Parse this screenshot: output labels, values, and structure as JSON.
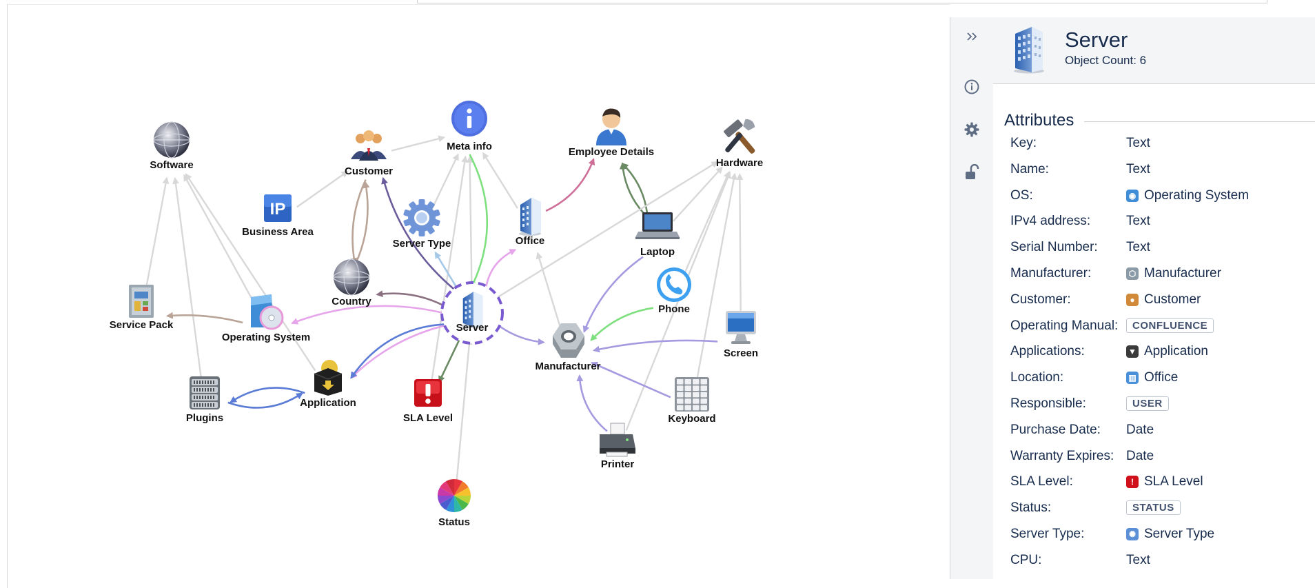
{
  "graph": {
    "nodes": [
      {
        "id": "software",
        "label": "Software",
        "icon": "globe-icon"
      },
      {
        "id": "customer",
        "label": "Customer",
        "icon": "people-icon"
      },
      {
        "id": "metainfo",
        "label": "Meta info",
        "icon": "info-icon"
      },
      {
        "id": "employee",
        "label": "Employee Details",
        "icon": "person-icon"
      },
      {
        "id": "hardware",
        "label": "Hardware",
        "icon": "tools-icon"
      },
      {
        "id": "businessarea",
        "label": "Business Area",
        "icon": "ip-icon"
      },
      {
        "id": "servertype",
        "label": "Server Type",
        "icon": "gear-icon"
      },
      {
        "id": "office",
        "label": "Office",
        "icon": "building-icon"
      },
      {
        "id": "laptop",
        "label": "Laptop",
        "icon": "laptop-icon"
      },
      {
        "id": "country",
        "label": "Country",
        "icon": "globe-icon"
      },
      {
        "id": "phone",
        "label": "Phone",
        "icon": "phone-icon"
      },
      {
        "id": "servicepack",
        "label": "Service Pack",
        "icon": "servicepack-icon"
      },
      {
        "id": "os",
        "label": "Operating System",
        "icon": "cd-icon"
      },
      {
        "id": "server",
        "label": "Server",
        "icon": "server-icon"
      },
      {
        "id": "manufacturer",
        "label": "Manufacturer",
        "icon": "nut-icon"
      },
      {
        "id": "screen",
        "label": "Screen",
        "icon": "monitor-icon"
      },
      {
        "id": "plugins",
        "label": "Plugins",
        "icon": "rack-icon"
      },
      {
        "id": "application",
        "label": "Application",
        "icon": "package-icon"
      },
      {
        "id": "sla",
        "label": "SLA Level",
        "icon": "alert-icon"
      },
      {
        "id": "keyboard",
        "label": "Keyboard",
        "icon": "keypad-icon"
      },
      {
        "id": "printer",
        "label": "Printer",
        "icon": "printer-icon"
      },
      {
        "id": "status",
        "label": "Status",
        "icon": "colorwheel-icon"
      }
    ],
    "selected": "server"
  },
  "toolbar": {
    "collapse_icon": "double-chevron-right-icon",
    "info_icon": "info-circle-icon",
    "settings_icon": "gear-icon",
    "lock_icon": "unlock-icon"
  },
  "panel": {
    "icon": "server-icon",
    "title": "Server",
    "count_text": "Object Count: 6",
    "attributes_title": "Attributes",
    "attributes": [
      {
        "key": "Key:",
        "value": "Text",
        "kind": "text"
      },
      {
        "key": "Name:",
        "value": "Text",
        "kind": "text"
      },
      {
        "key": "OS:",
        "value": "Operating System",
        "kind": "object",
        "icon": "cd-icon",
        "color": "#3f8dd6"
      },
      {
        "key": "IPv4 address:",
        "value": "Text",
        "kind": "text"
      },
      {
        "key": "Serial Number:",
        "value": "Text",
        "kind": "text"
      },
      {
        "key": "Manufacturer:",
        "value": "Manufacturer",
        "kind": "object",
        "icon": "nut-icon",
        "color": "#8a9aa6"
      },
      {
        "key": "Customer:",
        "value": "Customer",
        "kind": "object",
        "icon": "people-icon",
        "color": "#d08a3a"
      },
      {
        "key": "Operating Manual:",
        "value": "CONFLUENCE",
        "kind": "badge"
      },
      {
        "key": "Applications:",
        "value": "Application",
        "kind": "object",
        "icon": "package-icon",
        "color": "#3a3a3a"
      },
      {
        "key": "Location:",
        "value": "Office",
        "kind": "object",
        "icon": "building-icon",
        "color": "#4a90d9"
      },
      {
        "key": "Responsible:",
        "value": "USER",
        "kind": "badge"
      },
      {
        "key": "Purchase Date:",
        "value": "Date",
        "kind": "text"
      },
      {
        "key": "Warranty Expires:",
        "value": "Date",
        "kind": "text"
      },
      {
        "key": "SLA Level:",
        "value": "SLA Level",
        "kind": "object",
        "icon": "alert-icon",
        "color": "#d0101a"
      },
      {
        "key": "Status:",
        "value": "STATUS",
        "kind": "badge"
      },
      {
        "key": "Server Type:",
        "value": "Server Type",
        "kind": "object",
        "icon": "gear-icon",
        "color": "#5b8fd6"
      },
      {
        "key": "CPU:",
        "value": "Text",
        "kind": "text"
      }
    ]
  }
}
